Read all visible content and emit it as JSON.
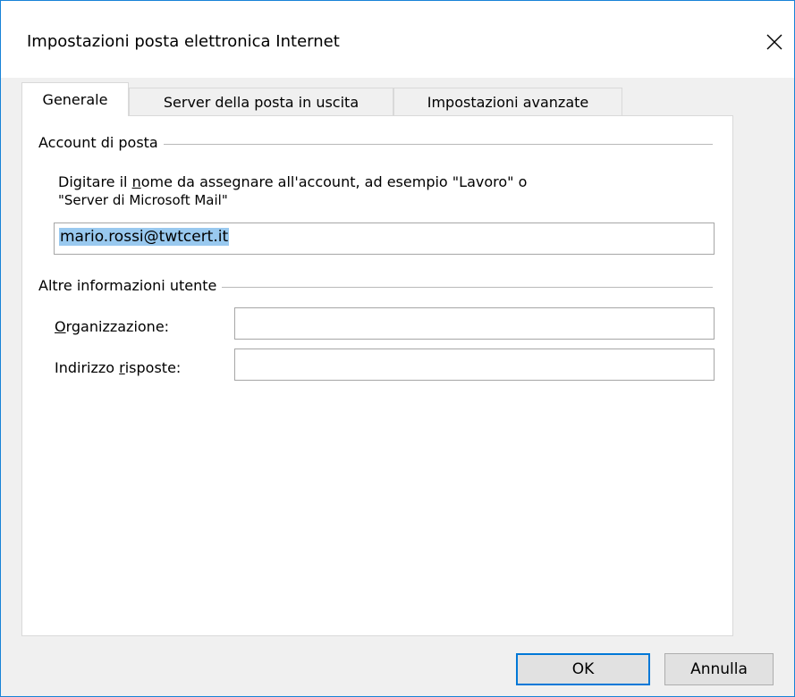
{
  "window": {
    "title": "Impostazioni posta elettronica Internet",
    "close_glyph": "✕",
    "accent_color": "#0078d7",
    "border_color": "#1883d7"
  },
  "tabs": [
    {
      "label": "Generale",
      "active": true
    },
    {
      "label": "Server della posta in uscita",
      "active": false
    },
    {
      "label": "Impostazioni avanzate",
      "active": false
    }
  ],
  "account_group": {
    "title": "Account di posta",
    "description_line1_pre": "Digitare il ",
    "description_line1_mnemonic": "n",
    "description_line1_post": "ome da assegnare all'account, ad esempio \"Lavoro\" o",
    "description_line2": "\"Server di Microsoft Mail\"",
    "account_name_value": "mario.rossi@twtcert.it"
  },
  "user_group": {
    "title": "Altre informazioni utente",
    "organization_label_mnemonic": "O",
    "organization_label_rest": "rganizzazione:",
    "organization_value": "",
    "reply_label_pre": "Indirizzo ",
    "reply_label_mnemonic": "r",
    "reply_label_post": "isposte:",
    "reply_value": ""
  },
  "buttons": {
    "ok_label": "OK",
    "cancel_label": "Annulla"
  }
}
